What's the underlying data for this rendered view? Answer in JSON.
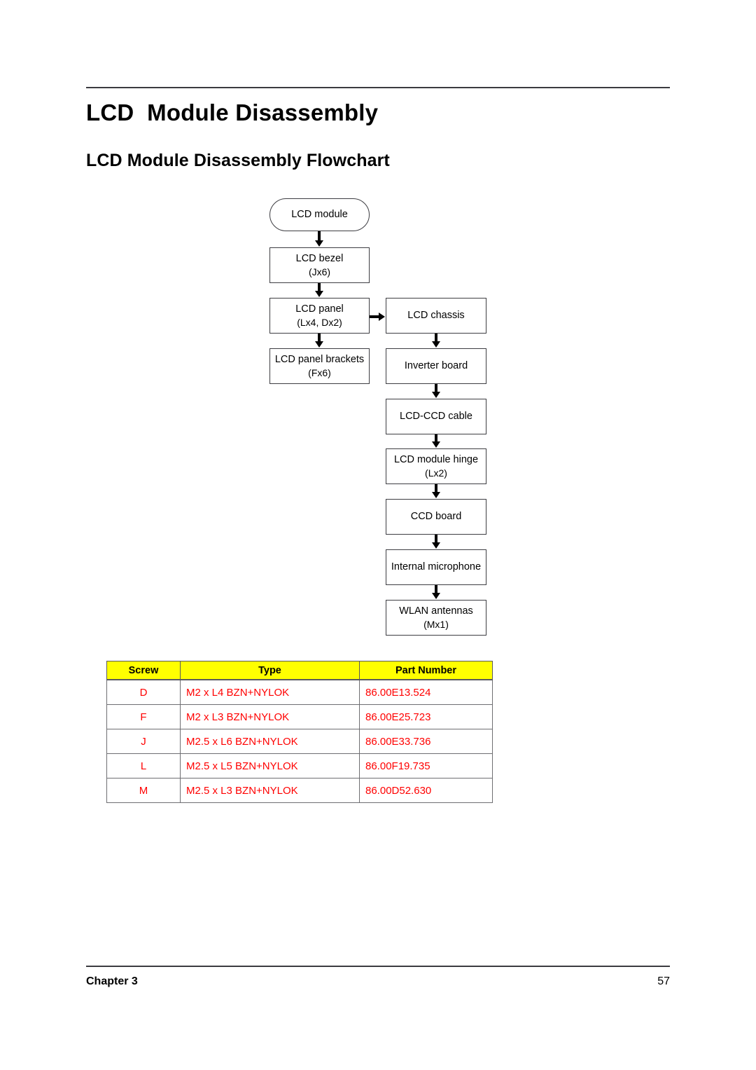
{
  "page": {
    "title": "LCD  Module Disassembly",
    "subtitle": "LCD Module Disassembly Flowchart",
    "footer_chapter": "Chapter 3",
    "footer_page": "57",
    "accent_header_bg": "#FFFF00",
    "accent_table_text": "#FF0000",
    "rule_color": "#3B3B40"
  },
  "flowchart": {
    "left_column": [
      {
        "label": "LCD module",
        "sub": "",
        "shape": "terminator"
      },
      {
        "label": "LCD bezel",
        "sub": "(Jx6)",
        "shape": "process"
      },
      {
        "label": "LCD panel",
        "sub": "(Lx4, Dx2)",
        "shape": "process"
      },
      {
        "label": "LCD panel brackets",
        "sub": "(Fx6)",
        "shape": "process"
      }
    ],
    "right_column": [
      {
        "label": "LCD chassis",
        "sub": "",
        "shape": "process"
      },
      {
        "label": "Inverter board",
        "sub": "",
        "shape": "process"
      },
      {
        "label": "LCD-CCD cable",
        "sub": "",
        "shape": "process"
      },
      {
        "label": "LCD module hinge",
        "sub": "(Lx2)",
        "shape": "process"
      },
      {
        "label": "CCD board",
        "sub": "",
        "shape": "process"
      },
      {
        "label": "Internal microphone",
        "sub": "",
        "shape": "process"
      },
      {
        "label": "WLAN antennas",
        "sub": "(Mx1)",
        "shape": "process"
      }
    ]
  },
  "screw_table": {
    "headers": [
      "Screw",
      "Type",
      "Part Number"
    ],
    "rows": [
      {
        "screw": "D",
        "type": "M2 x L4 BZN+NYLOK",
        "part": "86.00E13.524"
      },
      {
        "screw": "F",
        "type": "M2 x L3 BZN+NYLOK",
        "part": "86.00E25.723"
      },
      {
        "screw": "J",
        "type": "M2.5 x L6 BZN+NYLOK",
        "part": "86.00E33.736"
      },
      {
        "screw": "L",
        "type": "M2.5 x L5 BZN+NYLOK",
        "part": "86.00F19.735"
      },
      {
        "screw": "M",
        "type": "M2.5 x L3 BZN+NYLOK",
        "part": "86.00D52.630"
      }
    ]
  }
}
